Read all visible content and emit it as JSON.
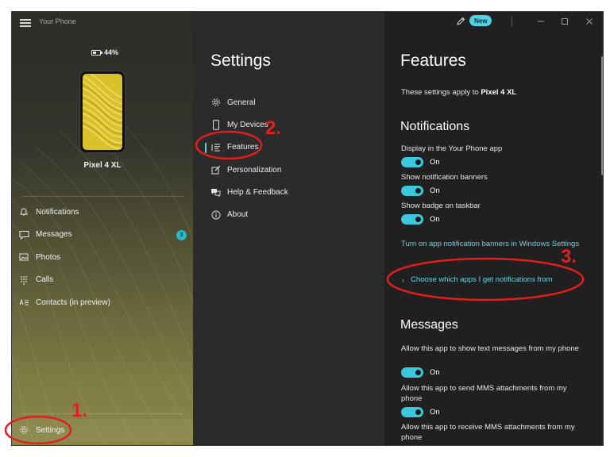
{
  "app": {
    "title": "Your Phone",
    "new_badge": "New",
    "colors": {
      "accent": "#3cc8dc",
      "link": "#6ecfe0",
      "annotation": "#e41d1d"
    }
  },
  "device": {
    "battery": "44%",
    "battery_level": 0.44,
    "name": "Pixel 4 XL"
  },
  "nav": {
    "items": [
      {
        "label": "Notifications",
        "icon": "bell-icon"
      },
      {
        "label": "Messages",
        "icon": "chat-icon",
        "badge": "3"
      },
      {
        "label": "Photos",
        "icon": "photo-icon"
      },
      {
        "label": "Calls",
        "icon": "dialpad-icon"
      },
      {
        "label": "Contacts (in preview)",
        "icon": "contacts-icon"
      }
    ],
    "settings_label": "Settings"
  },
  "settings_menu": {
    "title": "Settings",
    "items": [
      {
        "label": "General",
        "icon": "gear-icon"
      },
      {
        "label": "My Devices",
        "icon": "phone-icon"
      },
      {
        "label": "Features",
        "icon": "list-icon",
        "active": true
      },
      {
        "label": "Personalization",
        "icon": "brush-icon"
      },
      {
        "label": "Help & Feedback",
        "icon": "help-icon"
      },
      {
        "label": "About",
        "icon": "info-icon"
      }
    ]
  },
  "features": {
    "title": "Features",
    "applies_prefix": "These settings apply to ",
    "applies_device": "Pixel 4 XL",
    "notifications_heading": "Notifications",
    "notifications": [
      {
        "label": "Display in the Your Phone app",
        "state": "On"
      },
      {
        "label": "Show notification banners",
        "state": "On"
      },
      {
        "label": "Show badge on taskbar",
        "state": "On"
      }
    ],
    "windows_link": "Turn on app notification banners in Windows Settings",
    "choose_apps": "Choose which apps I get notifications from",
    "messages_heading": "Messages",
    "messages": [
      {
        "label": "Allow this app to show text messages from my phone",
        "state": "On"
      },
      {
        "label": "Allow this app to send MMS attachments from my phone",
        "state": "On"
      },
      {
        "label": "Allow this app to receive MMS attachments from my phone"
      }
    ]
  },
  "annotations": {
    "step1": "1.",
    "step2": "2.",
    "step3": "3."
  }
}
